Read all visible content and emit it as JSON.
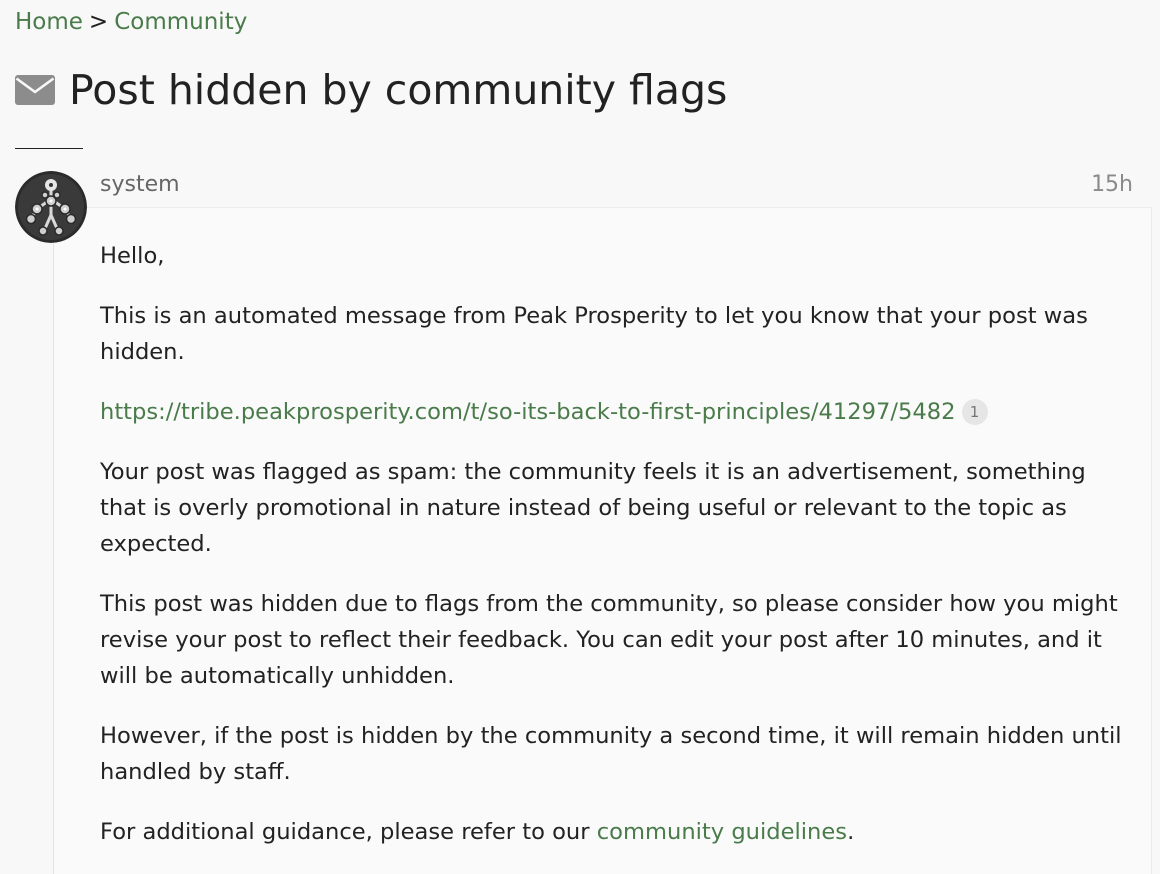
{
  "breadcrumb": {
    "home": "Home",
    "separator": ">",
    "community": "Community"
  },
  "topic": {
    "icon": "envelope-icon",
    "title": "Post hidden by community flags"
  },
  "post": {
    "author": "system",
    "date": "15h",
    "avatar": "robot-avatar",
    "greeting": "Hello,",
    "intro": "This is an automated message from Peak Prosperity to let you know that your post was hidden.",
    "link_url": "https://tribe.peakprosperity.com/t/so-its-back-to-first-principles/41297/5482",
    "link_clicks": "1",
    "flag_reason": "Your post was flagged as spam: the community feels it is an advertisement, something that is overly promotional in nature instead of being useful or relevant to the topic as expected.",
    "revise_note": "This post was hidden due to flags from the community, so please consider how you might revise your post to reflect their feedback. You can edit your post after 10 minutes, and it will be automatically unhidden.",
    "second_time_note": "However, if the post is hidden by the community a second time, it will remain hidden until handled by staff.",
    "guidance_prefix": "For additional guidance, please refer to our ",
    "guidance_link": "community guidelines",
    "guidance_suffix": "."
  },
  "colors": {
    "link": "#4a7b4a",
    "text": "#222222",
    "muted": "#666666",
    "background": "#f8f8f8"
  }
}
